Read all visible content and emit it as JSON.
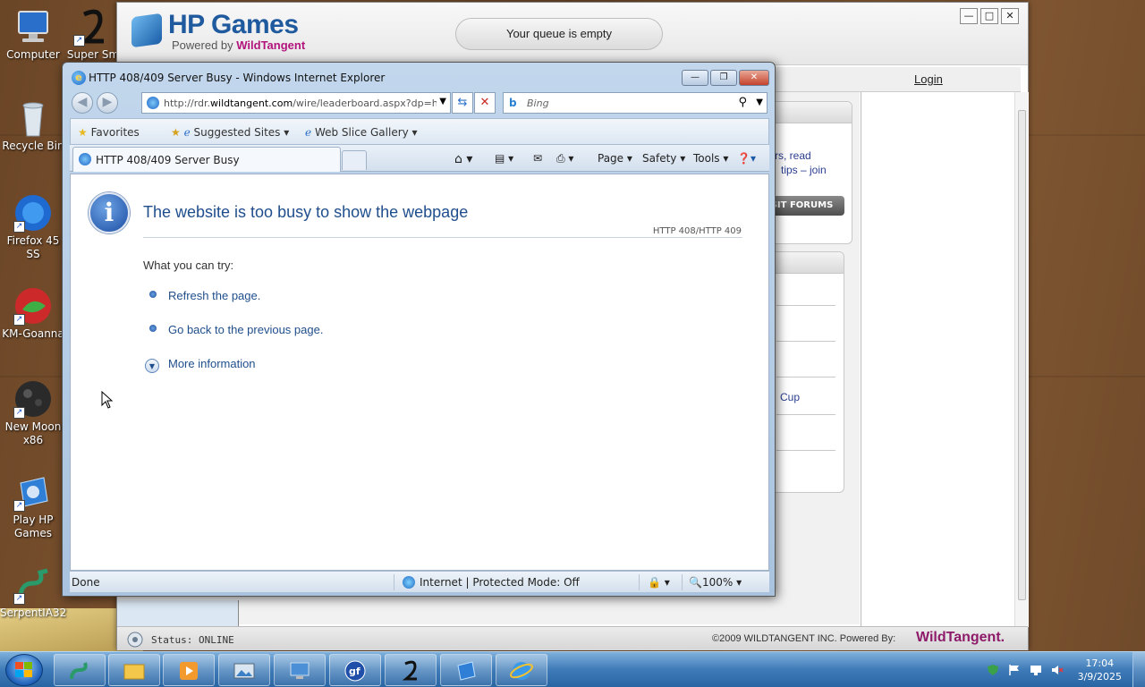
{
  "desktop": {
    "icons": [
      {
        "label": "Computer",
        "icon": "computer-icon"
      },
      {
        "label": "Super Sm",
        "icon": "super-smash-icon"
      },
      {
        "label": "Recycle Bin",
        "icon": "recycle-bin-icon"
      },
      {
        "label": "Firefox 45 SS",
        "icon": "firefox-icon"
      },
      {
        "label": "KM-Goanna",
        "icon": "goanna-icon"
      },
      {
        "label": "New Moon x86",
        "icon": "new-moon-icon"
      },
      {
        "label": "Play HP Games",
        "icon": "hp-games-icon"
      },
      {
        "label": "SerpentIA32",
        "icon": "serpent-icon"
      }
    ]
  },
  "hp_window": {
    "title": "HP Games",
    "subtitle_prefix": "Powered by ",
    "subtitle_brand": "WildTangent",
    "queue": "Your queue is empty",
    "login": "Login",
    "panel_text_1": "rs, read",
    "panel_text_2": "tips – join",
    "forums_button": "SIT FORUMS",
    "panel_item_cup": "Cup",
    "status": "Status: ONLINE",
    "copyright": "©2009 WILDTANGENT INC. Powered By:",
    "footer_brand": "WildTangent."
  },
  "ie_window": {
    "title": "HTTP 408/409 Server Busy - Windows Internet Explorer",
    "address_prefix": "http://rdr.",
    "address_domain": "wildtangent.com",
    "address_rest": "/wire/leaderboard.aspx?dp=hp",
    "search_placeholder": "Bing",
    "favorites": "Favorites",
    "suggested_sites": "Suggested Sites",
    "web_slice_gallery": "Web Slice Gallery",
    "tab_title": "HTTP 408/409 Server Busy",
    "commands": {
      "page": "Page",
      "safety": "Safety",
      "tools": "Tools"
    },
    "error_title": "The website is too busy to show the webpage",
    "error_code": "HTTP 408/HTTP 409",
    "what_you_can_try": "What you can try:",
    "links": [
      "Refresh the page.",
      "Go back to the previous page."
    ],
    "more_information": "More information",
    "status_done": "Done",
    "zone": "Internet | Protected Mode: Off",
    "zoom": "100%"
  },
  "taskbar": {
    "time": "17:04",
    "date": "3/9/2025"
  },
  "colors": {
    "ie_link": "#1f4e8c",
    "hp_brand": "#1f5a9f",
    "wildtangent": "#8e1a6a"
  }
}
